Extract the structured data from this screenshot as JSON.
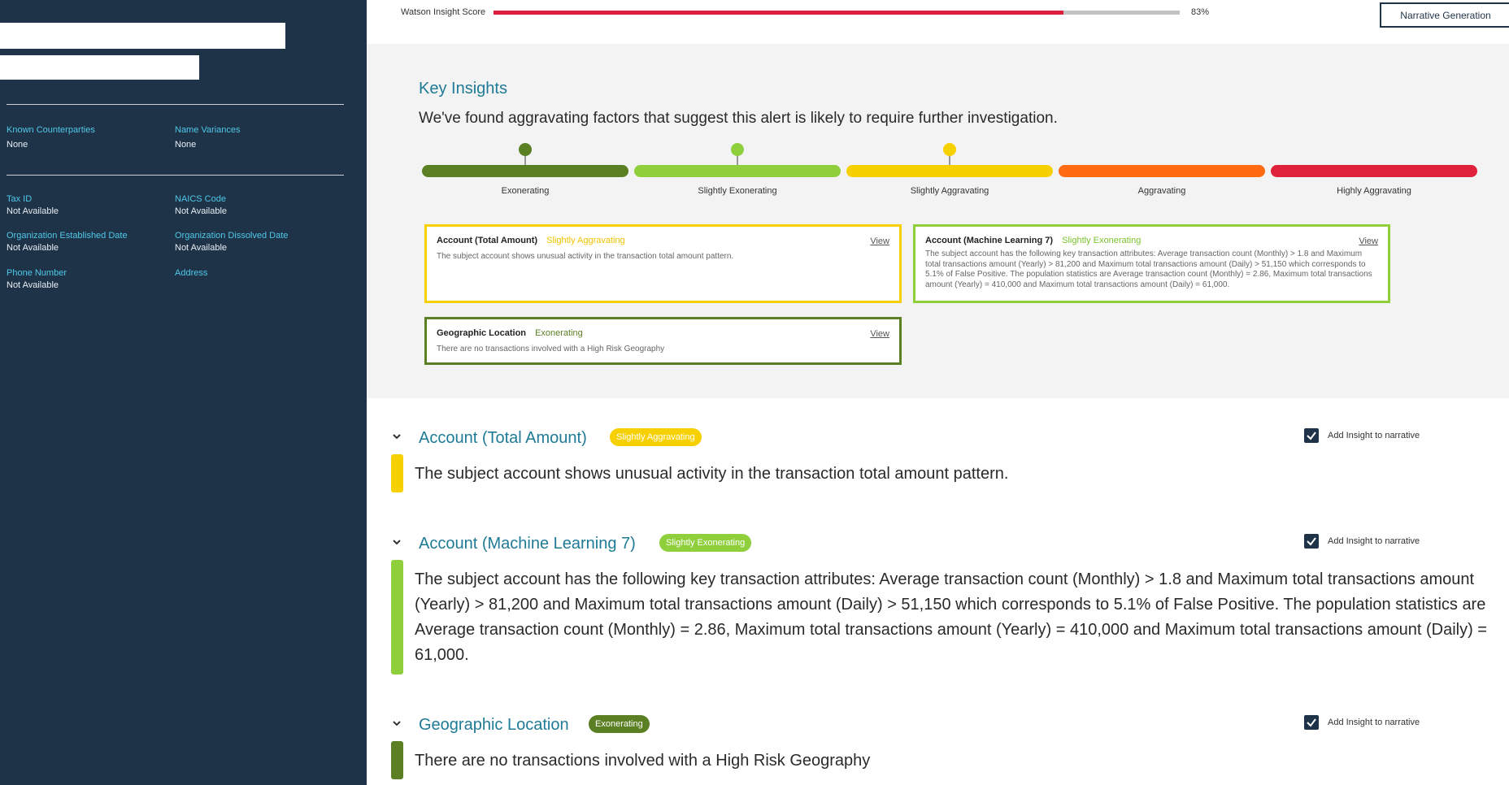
{
  "colors": {
    "sidebar_bg": "#1f3348",
    "accent_teal": "#1f7a96",
    "exonerating": "#5b7f23",
    "slightly_exonerating": "#8fcf3c",
    "slightly_aggravating": "#f7d000",
    "aggravating": "#ff6a12",
    "highly_aggravating": "#e0213a",
    "score_fill": "#dc1f3c"
  },
  "sidebar": {
    "fields": [
      {
        "label": "Known Counterparties",
        "value": "None"
      },
      {
        "label": "Name Variances",
        "value": "None"
      },
      {
        "label": "Tax ID",
        "value": "Not Available"
      },
      {
        "label": "NAICS Code",
        "value": "Not Available"
      },
      {
        "label": "Organization Established Date",
        "value": "Not Available"
      },
      {
        "label": "Organization Dissolved Date",
        "value": "Not Available"
      },
      {
        "label": "Phone Number",
        "value": "Not Available"
      },
      {
        "label": "Address",
        "value": ""
      }
    ]
  },
  "topbar": {
    "score_label": "Watson Insight Score",
    "score_value": "83%",
    "score_fraction": 0.83,
    "narrative_button": "Narrative Generation"
  },
  "key_insights": {
    "title": "Key Insights",
    "subtitle": "We've found aggravating factors that suggest this alert is likely to require further investigation.",
    "scale": [
      {
        "label": "Exonerating"
      },
      {
        "label": "Slightly Exonerating"
      },
      {
        "label": "Slightly Aggravating"
      },
      {
        "label": "Aggravating"
      },
      {
        "label": "Highly Aggravating"
      }
    ],
    "cards": [
      {
        "title": "Account (Total Amount)",
        "tag": "Slightly Aggravating",
        "view": "View",
        "body": "The subject account shows unusual activity in the transaction total amount pattern."
      },
      {
        "title": "Account (Machine Learning 7)",
        "tag": "Slightly Exonerating",
        "view": "View",
        "body": "The subject account has the following key transaction attributes: Average transaction count (Monthly) > 1.8 and Maximum total transactions amount (Yearly) > 81,200 and Maximum total transactions amount (Daily) > 51,150 which corresponds to 5.1% of False Positive. The population statistics are Average transaction count (Monthly) = 2.86, Maximum total transactions amount (Yearly) = 410,000 and Maximum total transactions amount (Daily) = 61,000."
      },
      {
        "title": "Geographic Location",
        "tag": "Exonerating",
        "view": "View",
        "body": "There are no transactions involved with a High Risk Geography"
      }
    ]
  },
  "details": [
    {
      "title": "Account (Total Amount)",
      "badge": "Slightly Aggravating",
      "checkbox_label": "Add Insight to narrative",
      "text": "The subject account shows unusual activity in the transaction total amount pattern."
    },
    {
      "title": "Account (Machine Learning 7)",
      "badge": "Slightly Exonerating",
      "checkbox_label": "Add Insight to narrative",
      "text": "The subject account has the following key transaction attributes: Average transaction count (Monthly) > 1.8 and Maximum total transactions amount (Yearly) > 81,200 and Maximum total transactions amount (Daily) > 51,150 which corresponds to 5.1% of False Positive. The population statistics are Average transaction count (Monthly) = 2.86, Maximum total transactions amount (Yearly) = 410,000 and Maximum total transactions amount (Daily) = 61,000."
    },
    {
      "title": "Geographic Location",
      "badge": "Exonerating",
      "checkbox_label": "Add Insight to narrative",
      "text": "There are no transactions involved with a High Risk Geography"
    }
  ]
}
